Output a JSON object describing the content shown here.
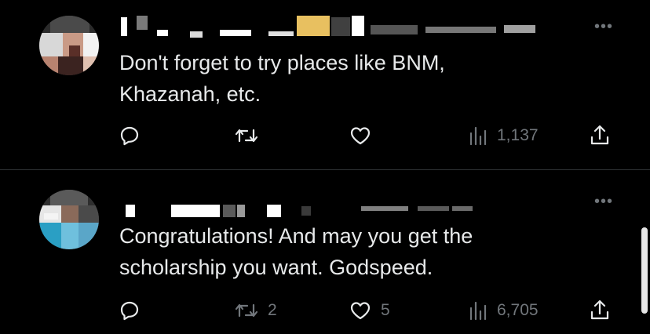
{
  "tweets": [
    {
      "text": "Don't forget to try places like BNM,\nKhazanah, etc.",
      "reply_count": "",
      "retweet_count": "",
      "like_count": "",
      "view_count": "1,137"
    },
    {
      "text": "Congratulations! And may you get the\nscholarship you want. Godspeed.",
      "reply_count": "",
      "retweet_count": "2",
      "like_count": "5",
      "view_count": "6,705"
    }
  ],
  "icons": {
    "more": "more-horizontal-icon",
    "reply": "reply-bubble-icon",
    "retweet": "retweet-icon",
    "like": "heart-icon",
    "views": "views-bar-chart-icon",
    "share": "share-upload-icon"
  },
  "colors": {
    "background": "#000000",
    "text": "#e7e9ea",
    "secondary": "#71767b",
    "divider": "#2f3336"
  }
}
